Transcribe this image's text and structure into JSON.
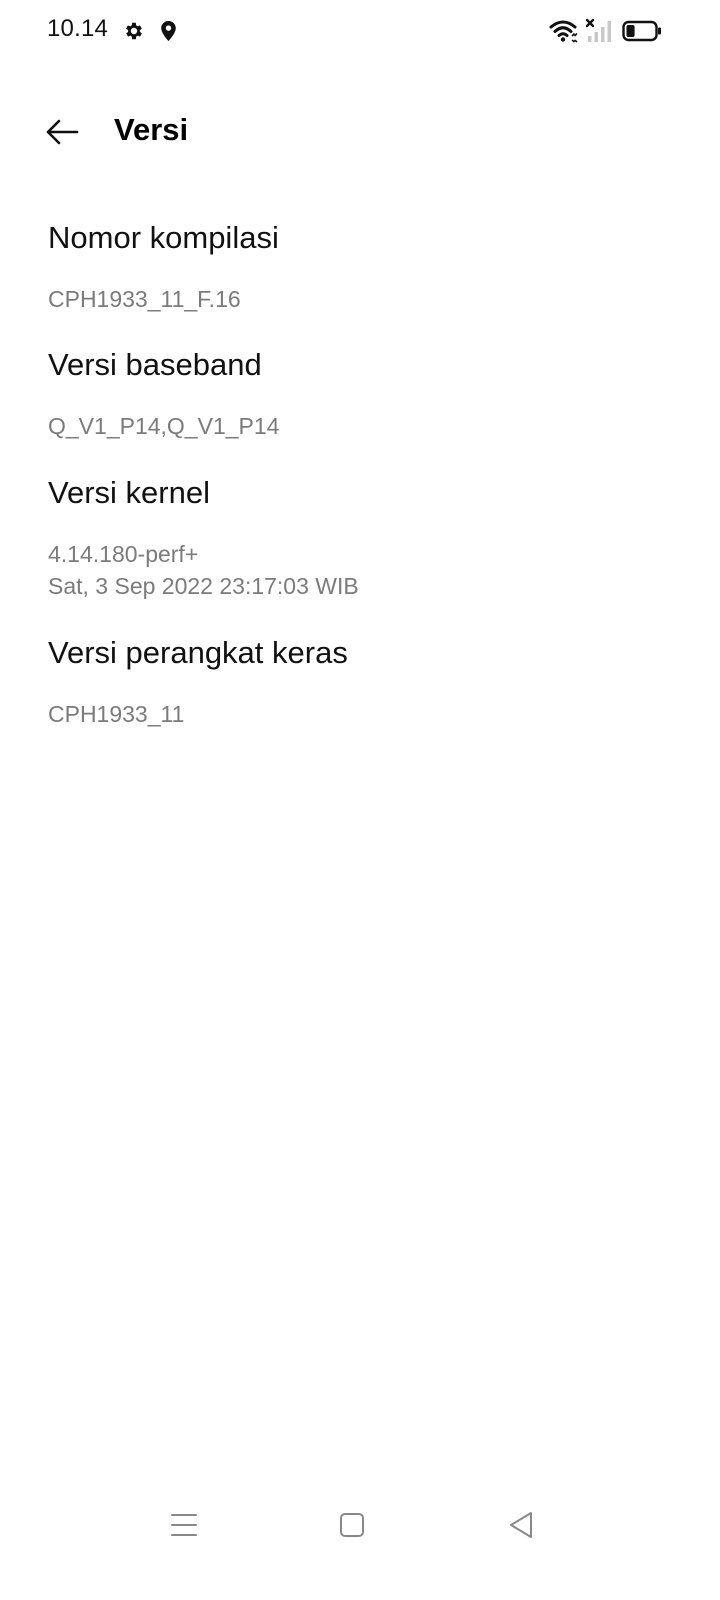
{
  "status_bar": {
    "time": "10.14",
    "icons": [
      "gear-icon",
      "location-pin-icon",
      "wifi-icon",
      "signal-no-service-icon",
      "battery-icon"
    ],
    "battery_level": 0.3
  },
  "app_bar": {
    "back_icon": "arrow-left-icon",
    "title": "Versi"
  },
  "items": [
    {
      "title": "Nomor kompilasi",
      "values": [
        "CPH1933_11_F.16"
      ]
    },
    {
      "title": "Versi baseband",
      "values": [
        "Q_V1_P14,Q_V1_P14"
      ]
    },
    {
      "title": "Versi kernel",
      "values": [
        "4.14.180-perf+",
        "Sat, 3 Sep 2022 23:17:03 WIB"
      ]
    },
    {
      "title": "Versi perangkat keras",
      "values": [
        "CPH1933_11"
      ]
    }
  ],
  "nav_bar": {
    "icons": [
      "menu-icon",
      "home-square-icon",
      "back-triangle-icon"
    ]
  }
}
